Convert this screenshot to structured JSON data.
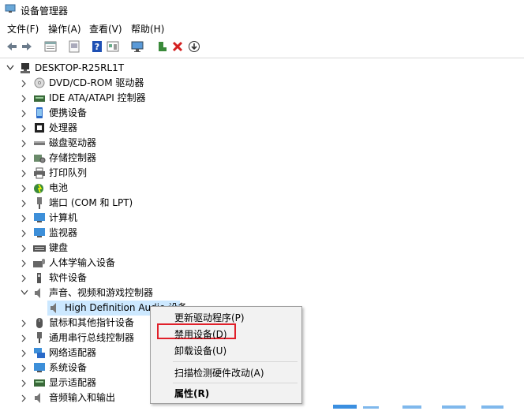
{
  "window": {
    "title": "设备管理器",
    "icon": "device-manager-icon"
  },
  "menubar": [
    "文件(F)",
    "操作(A)",
    "查看(V)",
    "帮助(H)"
  ],
  "toolbar": {
    "icons": [
      "back-arrow-icon",
      "forward-arrow-icon",
      "properties-icon",
      "update-driver-icon",
      "help-icon",
      "view-icon",
      "monitor-icon",
      "add-driver-icon",
      "uninstall-x-icon",
      "download-icon"
    ]
  },
  "tree": {
    "root": "DESKTOP-R25RL1T",
    "items": [
      "DVD/CD-ROM 驱动器",
      "IDE ATA/ATAPI 控制器",
      "便携设备",
      "处理器",
      "磁盘驱动器",
      "存储控制器",
      "打印队列",
      "电池",
      "端口 (COM 和 LPT)",
      "计算机",
      "监视器",
      "键盘",
      "人体学输入设备",
      "软件设备",
      "声音、视频和游戏控制器"
    ],
    "expanded_child": "High Definition Audio 设备",
    "items_after": [
      "鼠标和其他指针设备",
      "通用串行总线控制器",
      "网络适配器",
      "系统设备",
      "显示适配器",
      "音频输入和输出"
    ]
  },
  "context_menu": {
    "items": [
      "更新驱动程序(P)",
      "禁用设备(D)",
      "卸载设备(U)",
      "扫描检测硬件改动(A)",
      "属性(R)"
    ],
    "highlighted": "禁用设备(D)",
    "highlight_color": "#e0202a"
  },
  "colors": {
    "selection": "#cce8ff",
    "menu_bg": "#f2f2f2"
  }
}
